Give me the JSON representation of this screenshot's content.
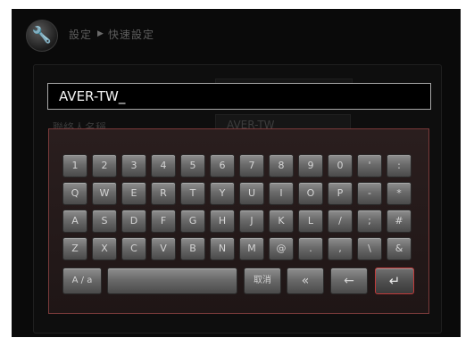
{
  "header": {
    "crumb_settings": "設定",
    "crumb_separator": "▶",
    "crumb_quick": "快速設定",
    "icon": "wrench-icon"
  },
  "form": {
    "contact_label": "聯絡人名稱",
    "contact_value": "AVER-TW"
  },
  "input": {
    "value": "AVER-TW_"
  },
  "keyboard": {
    "row1": [
      "1",
      "2",
      "3",
      "4",
      "5",
      "6",
      "7",
      "8",
      "9",
      "0",
      "'",
      ":"
    ],
    "row2": [
      "Q",
      "W",
      "E",
      "R",
      "T",
      "Y",
      "U",
      "I",
      "O",
      "P",
      "-",
      "*"
    ],
    "row3": [
      "A",
      "S",
      "D",
      "F",
      "G",
      "H",
      "J",
      "K",
      "L",
      "/",
      ";",
      "#"
    ],
    "row4": [
      "Z",
      "X",
      "C",
      "V",
      "B",
      "N",
      "M",
      "@",
      ".",
      ",",
      "\\",
      "&"
    ],
    "shift_label": "A / a",
    "cancel_label": "取消",
    "backspace_label": "«",
    "left_label": "←",
    "enter_label": "↵"
  },
  "colors": {
    "keyboard_border": "#7a3a3a",
    "enter_border": "#c23a3a"
  }
}
